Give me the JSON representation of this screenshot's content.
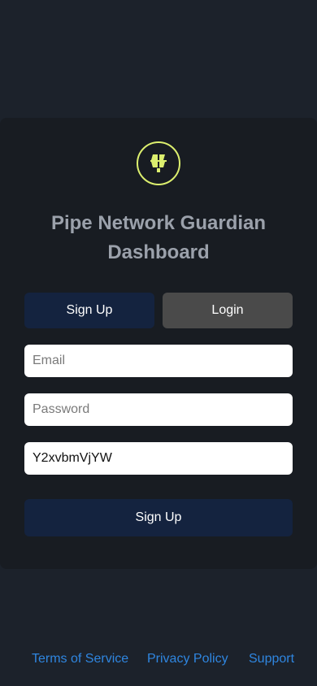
{
  "app": {
    "title": "Pipe Network Guardian Dashboard",
    "logo_icon": "pipe-network-logo-icon",
    "accent_color": "#dcef6e"
  },
  "tabs": {
    "signup_label": "Sign Up",
    "login_label": "Login"
  },
  "form": {
    "email": {
      "value": "",
      "placeholder": "Email"
    },
    "password": {
      "value": "",
      "placeholder": "Password"
    },
    "referral_code": {
      "value": "Y2xvbmVjYW",
      "placeholder": ""
    },
    "submit_label": "Sign Up"
  },
  "footer": {
    "links": [
      "Terms of Service",
      "Privacy Policy",
      "Support"
    ]
  }
}
